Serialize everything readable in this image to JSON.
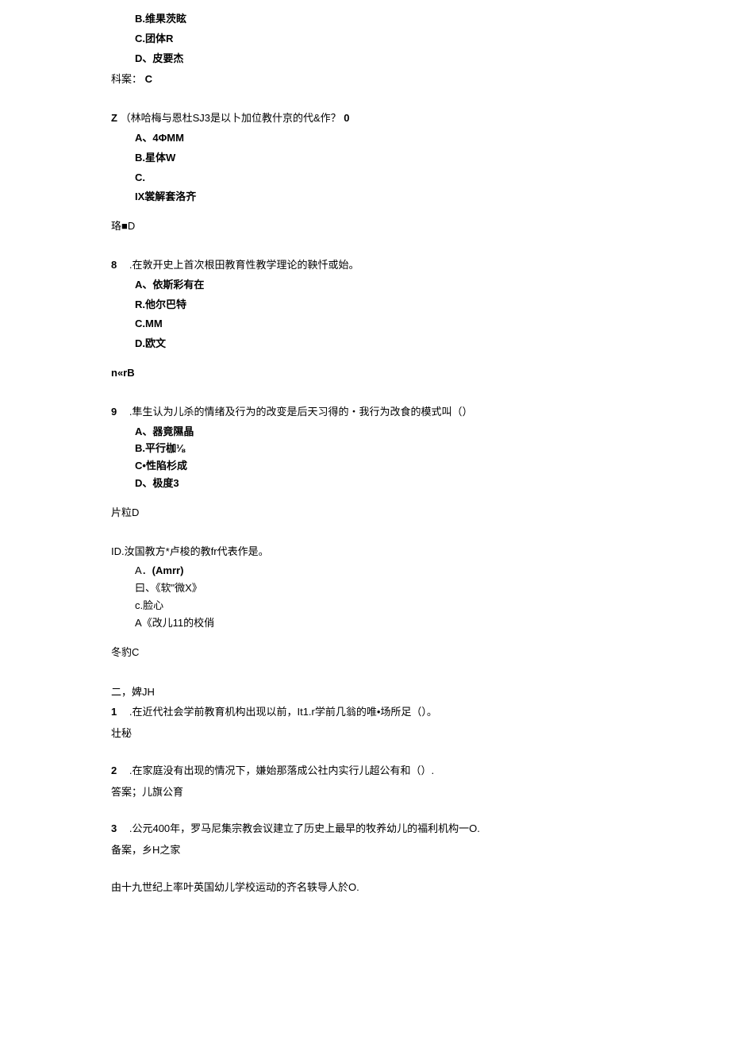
{
  "q6": {
    "optB": "B.维果茨眩",
    "optC": "C.团体R",
    "optD": "D、皮要杰",
    "answer_label": "科案：",
    "answer_val": "C"
  },
  "q7": {
    "stem_prefix": "Z",
    "stem_text": "（林哈梅与恩杜SJ3是以卜加位教什京的代&作？",
    "stem_suffix": "0",
    "optA": "A、4ΦMM",
    "optB": "B.星体W",
    "optC": "C.",
    "optC2": "IX裳解套洛齐",
    "answer": "珞■D"
  },
  "q8": {
    "num": "8",
    "stem": ".在敦开史上首次根田教育性教学理论的鞅忏或始。",
    "optA": "A、依斯彩有在",
    "optB": "R.他尔巴特",
    "optC": "C.MM",
    "optD": "D.欧文",
    "answer": "n«rB"
  },
  "q9": {
    "num": "9",
    "stem": ".隼生认为儿杀的情绪及行为的改变是后天习得的・我行为改食的模式叫（）",
    "optA": "A、器竟隰晶",
    "optB": "B.平行枷⅛",
    "optC": "C•性陷杉成",
    "optD": "D、极度3",
    "answer": "片粒D"
  },
  "q10": {
    "stem": "ID.汝国教方*卢梭的教fr代表作是。",
    "optA": "A．(Amrr)",
    "optB": "曰、《软\"微X》",
    "optC": "c.脸心",
    "optD": "A《改儿11的校俏",
    "answer": "冬豹C"
  },
  "section2": {
    "header": "二，婢JH",
    "f1": {
      "num": "1",
      "stem": ".在近代社会学前教育机构出现以前，It1.r学前几翁的唯•场所足（）。",
      "answer": "壮秘"
    },
    "f2": {
      "num": "2",
      "stem": ".在家庭没有出现的情况下，嫌始那落成公社内实行儿超公有和（）.",
      "answer": "答案；儿旗公育"
    },
    "f3": {
      "num": "3",
      "stem": ".公元400年，罗马尼集宗教会议建立了历史上最早的牧养幼儿的福利机构一O.",
      "answer": "备案，乡H之家"
    },
    "f4": {
      "stem": "由十九世纪上率叶英国幼儿学校运动的齐名轶导人於O."
    }
  }
}
